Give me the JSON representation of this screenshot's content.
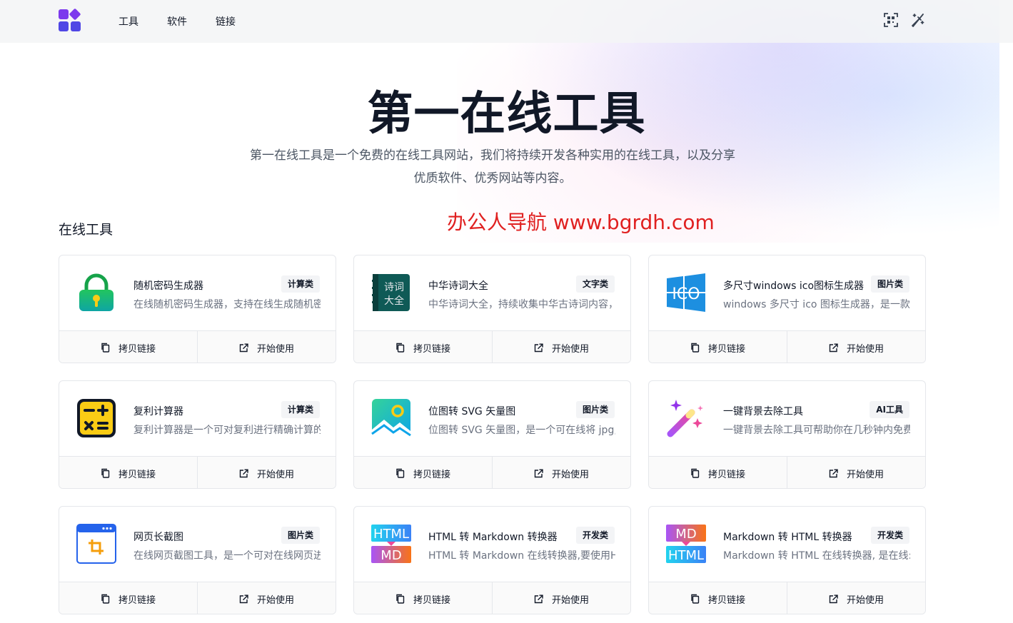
{
  "nav": {
    "items": [
      "工具",
      "软件",
      "链接"
    ],
    "right_icons": [
      "qr-code-icon",
      "theme-toggle-icon"
    ]
  },
  "hero": {
    "title": "第一在线工具",
    "description": "第一在线工具是一个免费的在线工具网站，我们将持续开发各种实用的在线工具，以及分享优质软件、优秀网站等内容。"
  },
  "section": {
    "title": "在线工具"
  },
  "watermark": "办公人导航 www.bgrdh.com",
  "actions": {
    "copy_label": "拷贝链接",
    "start_label": "开始使用"
  },
  "cards": [
    {
      "name": "随机密码生成器",
      "badge": "计算类",
      "desc": "在线随机密码生成器，支持在线生成随机密码",
      "icon": "padlock-icon"
    },
    {
      "name": "中华诗词大全",
      "badge": "文字类",
      "desc": "中华诗词大全，持续收集中华古诗词内容，",
      "icon": "poetry-book-icon"
    },
    {
      "name": "多尺寸windows ico图标生成器",
      "badge": "图片类",
      "desc": "windows 多尺寸 ico 图标生成器，是一款",
      "icon": "windows-ico-icon"
    },
    {
      "name": "复利计算器",
      "badge": "计算类",
      "desc": "复利计算器是一个可对复利进行精确计算的",
      "icon": "calculator-icon"
    },
    {
      "name": "位图转 SVG 矢量图",
      "badge": "图片类",
      "desc": "位图转 SVG 矢量图，是一个可在线将 jpg,",
      "icon": "image-landscape-icon"
    },
    {
      "name": "一键背景去除工具",
      "badge": "AI工具",
      "desc": "一键背景去除工具可帮助你在几秒钟内免费",
      "icon": "magic-wand-icon"
    },
    {
      "name": "网页长截图",
      "badge": "图片类",
      "desc": "在线网页截图工具，是一个可对在线网页进",
      "icon": "screenshot-crop-icon"
    },
    {
      "name": "HTML 转 Markdown 转换器",
      "badge": "开发类",
      "desc": "HTML 转 Markdown 在线转换器,要使用H",
      "icon": "html-to-md-icon",
      "top": "HTML",
      "bottom": "MD"
    },
    {
      "name": "Markdown 转 HTML 转换器",
      "badge": "开发类",
      "desc": "Markdown 转 HTML 在线转换器, 是在线:",
      "icon": "md-to-html-icon",
      "top": "MD",
      "bottom": "HTML"
    }
  ]
}
